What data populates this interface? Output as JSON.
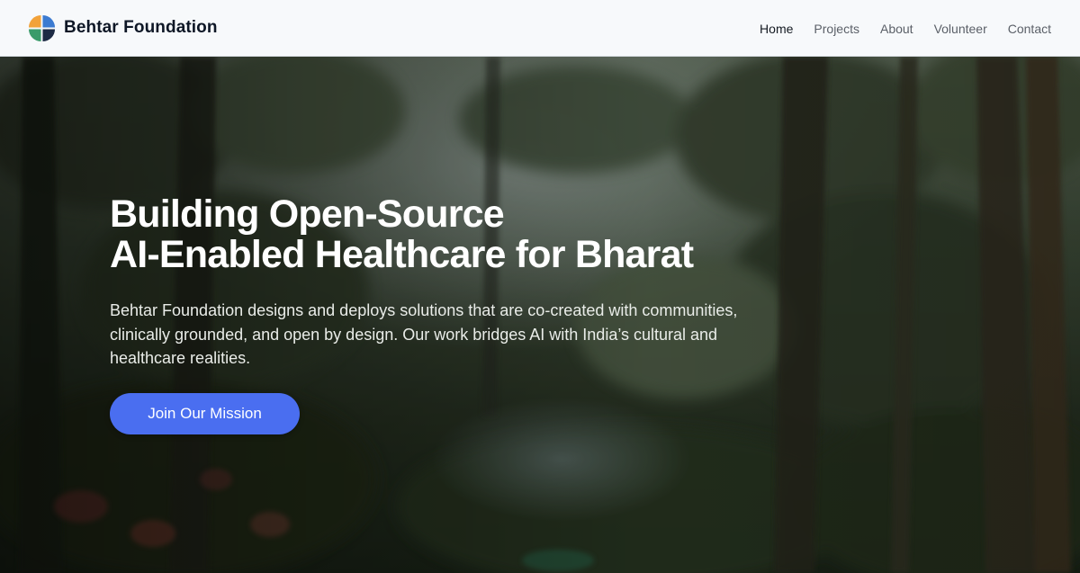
{
  "header": {
    "brand_name": "Behtar Foundation",
    "logo_icon": "quartered-circle-logo",
    "nav": [
      {
        "label": "Home",
        "active": true
      },
      {
        "label": "Projects",
        "active": false
      },
      {
        "label": "About",
        "active": false
      },
      {
        "label": "Volunteer",
        "active": false
      },
      {
        "label": "Contact",
        "active": false
      }
    ]
  },
  "hero": {
    "title_line1": "Building Open-Source",
    "title_line2": "AI-Enabled Healthcare for Bharat",
    "description": "Behtar Foundation designs and deploys solutions that are co-created with communities, clinically grounded, and open by design. Our work bridges AI with India’s cultural and healthcare realities.",
    "cta_label": "Join Our Mission",
    "background": "forest-painting-image"
  },
  "colors": {
    "accent": "#4a6ef0",
    "header_bg": "#f7f9fb",
    "brand_text": "#0e1726",
    "logo_orange": "#f2a23a",
    "logo_blue": "#3c7bd1",
    "logo_green": "#3a9b6a",
    "logo_navy": "#1d2a44"
  }
}
